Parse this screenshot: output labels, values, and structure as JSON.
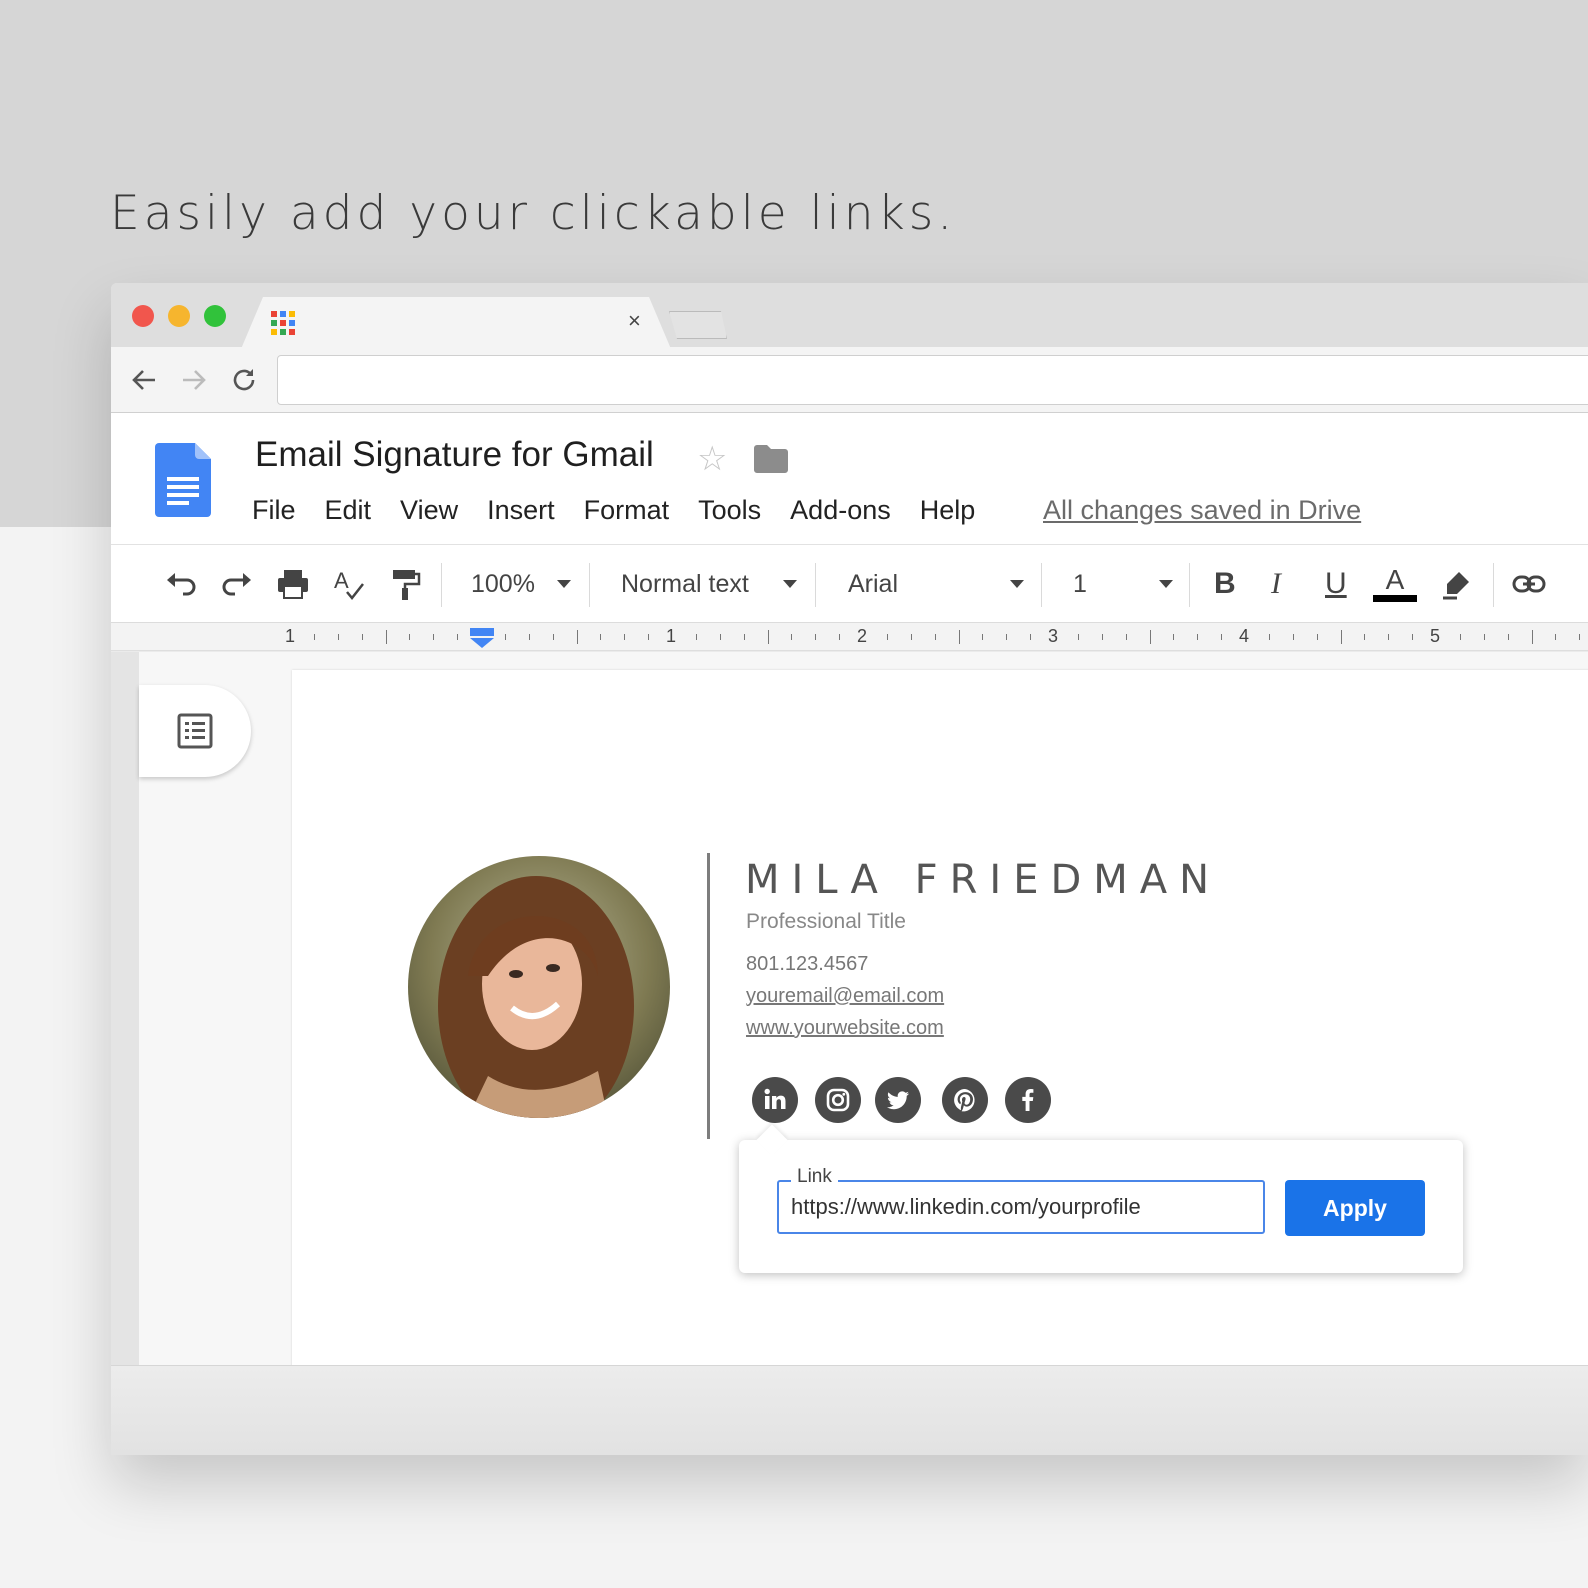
{
  "headline": "Easily add your clickable links.",
  "browser": {
    "tab_close": "×",
    "url": ""
  },
  "docs": {
    "title": "Email Signature for Gmail",
    "menu": [
      "File",
      "Edit",
      "View",
      "Insert",
      "Format",
      "Tools",
      "Add-ons",
      "Help"
    ],
    "saved_status": "All changes saved in Drive"
  },
  "toolbar": {
    "zoom": "100%",
    "style": "Normal text",
    "font": "Arial",
    "font_size": "1",
    "bold": "B",
    "italic": "I",
    "underline": "U",
    "text_color": "A"
  },
  "ruler": {
    "labels": [
      "1",
      "1",
      "2",
      "3",
      "4",
      "5"
    ]
  },
  "signature": {
    "name": "MILA FRIEDMAN",
    "title": "Professional Title",
    "phone": "801.123.4567",
    "email": "youremail@email.com",
    "website": "www.yourwebsite.com",
    "social": [
      "linkedin-icon",
      "instagram-icon",
      "twitter-icon",
      "pinterest-icon",
      "facebook-icon"
    ]
  },
  "link_popup": {
    "label": "Link",
    "value": "https://www.linkedin.com/yourprofile",
    "apply_label": "Apply"
  },
  "colors": {
    "accent": "#1a73e8",
    "docs_blue": "#4285f4",
    "social_bg": "#4a4a4a"
  }
}
